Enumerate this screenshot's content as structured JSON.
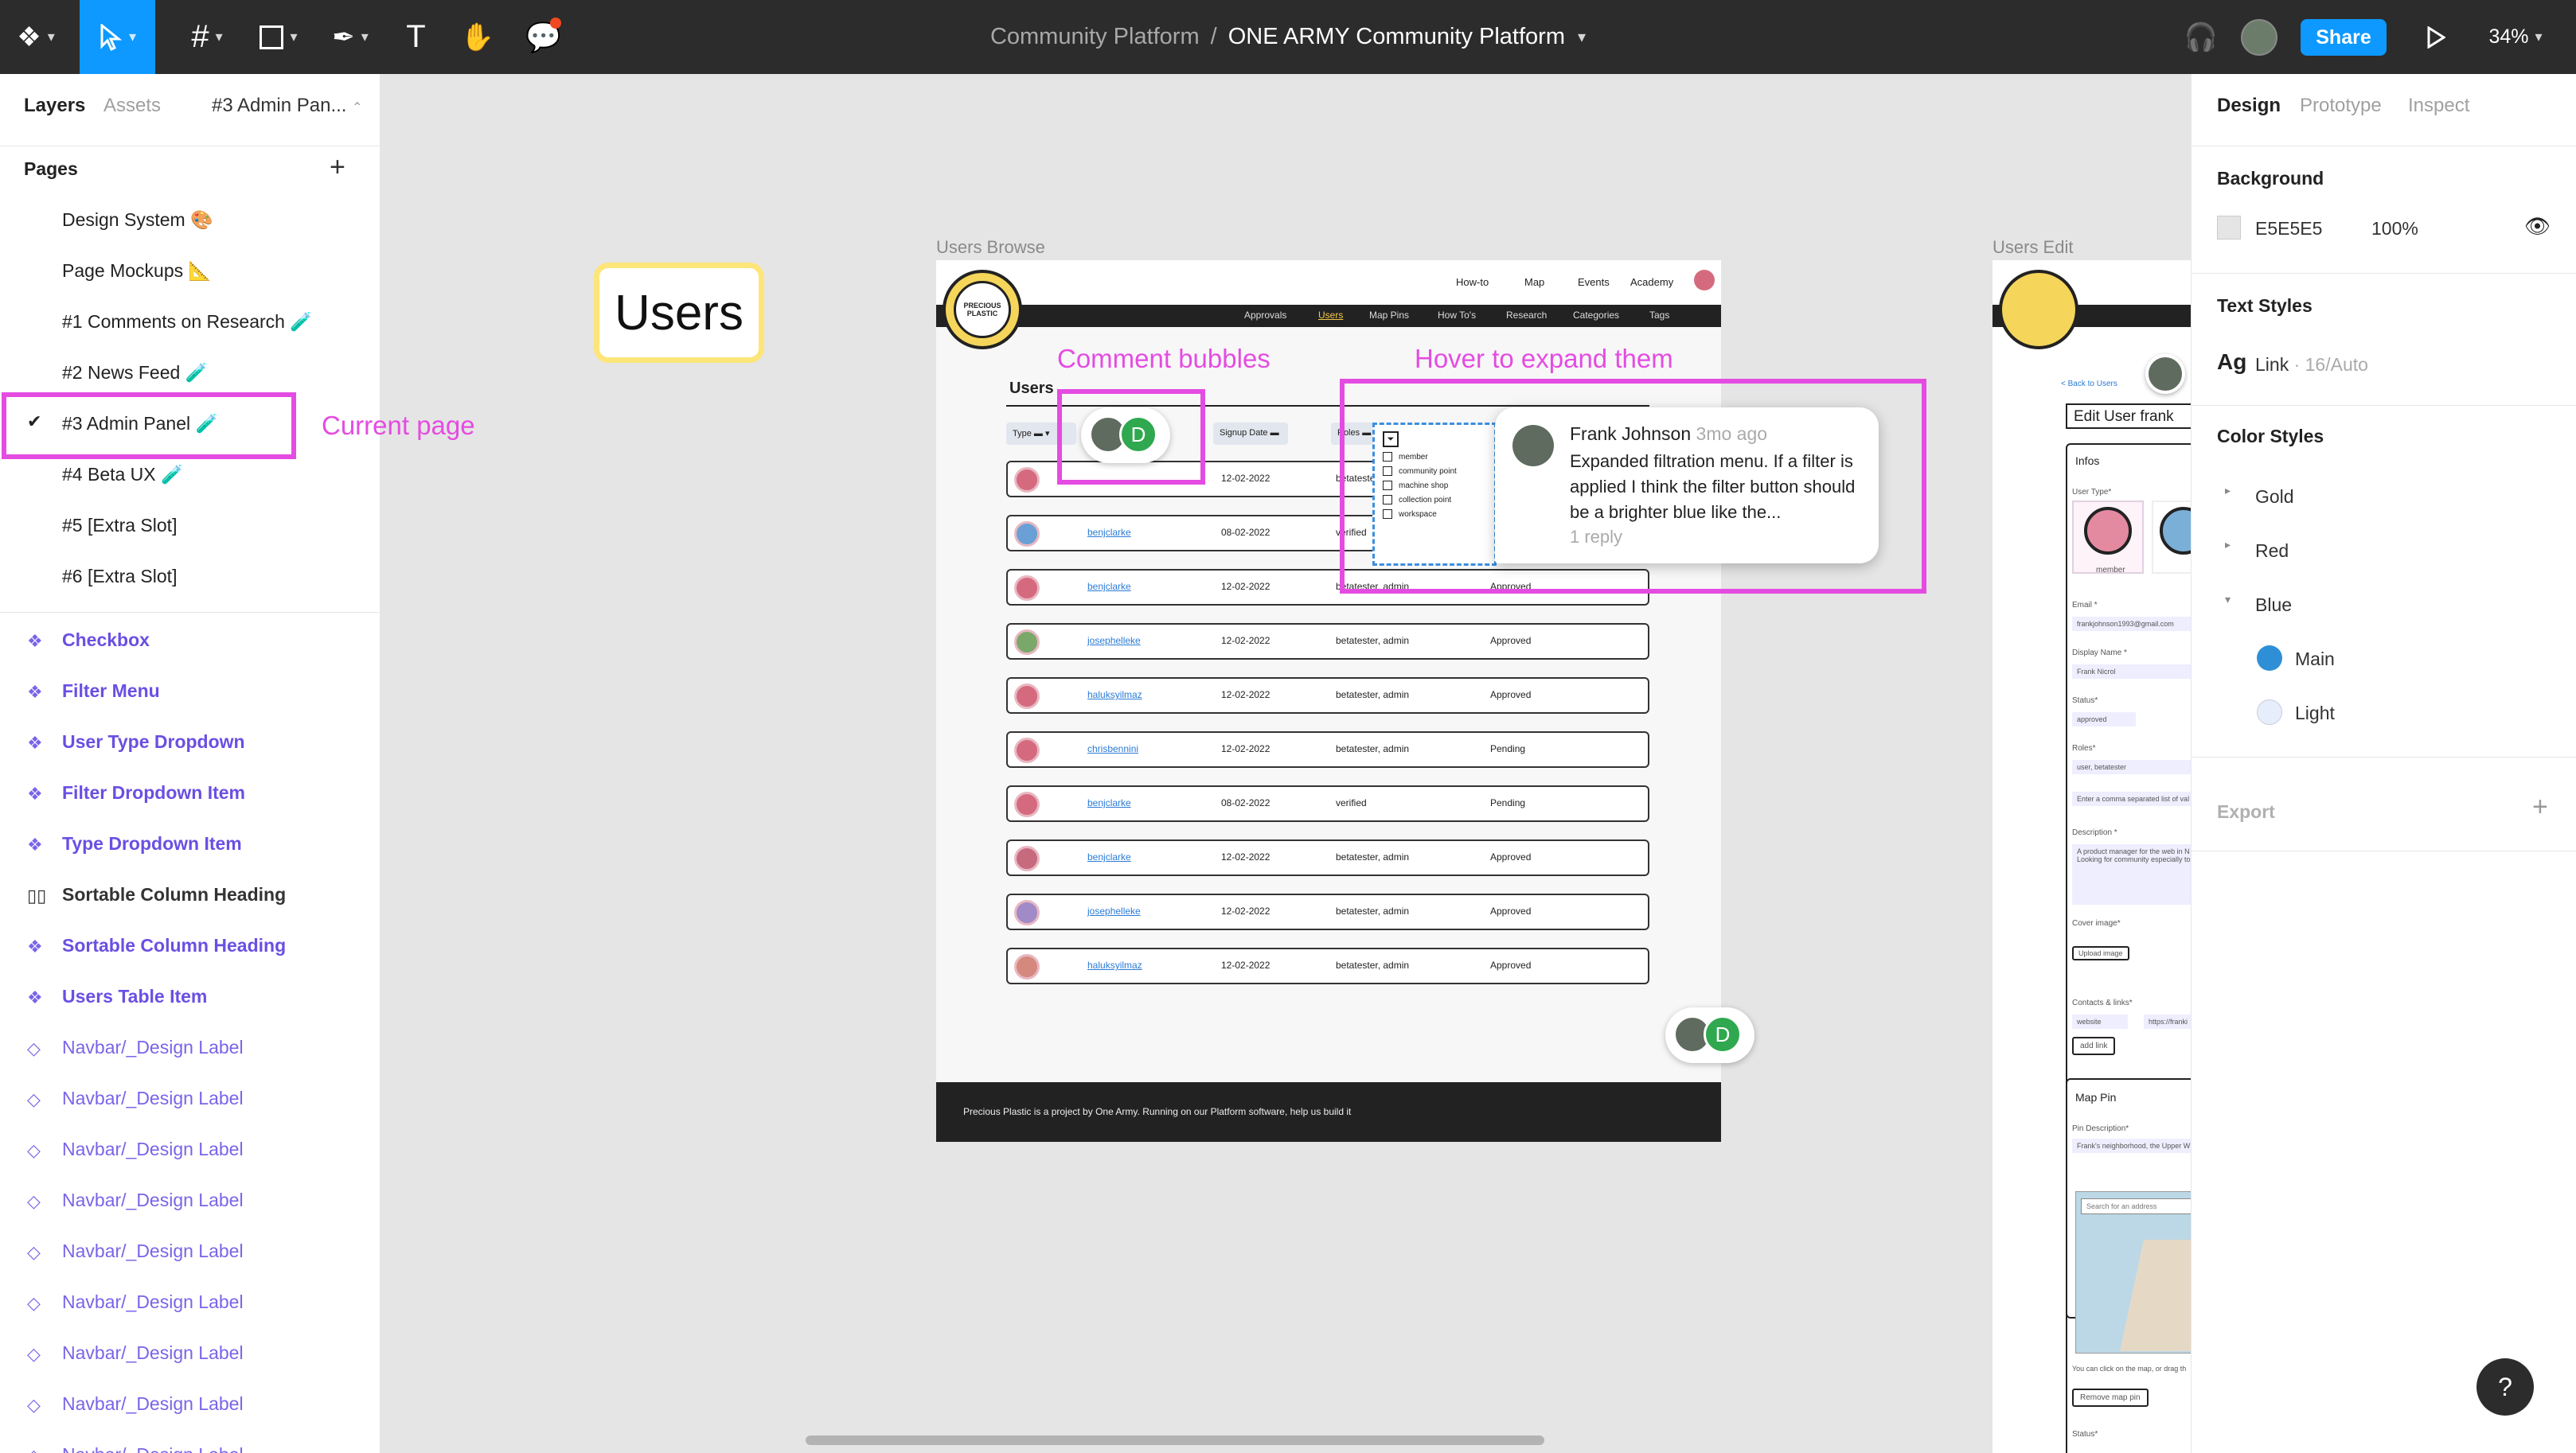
{
  "toolbar": {
    "breadcrumb_team": "Community Platform",
    "separator": "/",
    "file_name": "ONE ARMY Community Platform",
    "share_label": "Share",
    "zoom": "34%"
  },
  "left_panel": {
    "tabs": [
      "Layers",
      "Assets"
    ],
    "current_page_tab": "#3 Admin Pan...",
    "pages_title": "Pages",
    "pages": [
      "Design System 🎨",
      "Page Mockups 📐",
      "#1 Comments on Research 🧪",
      "#2 News Feed 🧪",
      "#3 Admin Panel 🧪",
      "#4 Beta UX 🧪",
      "#5 [Extra Slot]",
      "#6 [Extra Slot]"
    ],
    "layers": [
      {
        "label": "Checkbox",
        "kind": "comp"
      },
      {
        "label": "Filter Menu",
        "kind": "comp"
      },
      {
        "label": "User Type Dropdown",
        "kind": "comp"
      },
      {
        "label": "Filter Dropdown Item",
        "kind": "comp"
      },
      {
        "label": "Type Dropdown Item",
        "kind": "comp"
      },
      {
        "label": "Sortable Column Heading",
        "kind": "norm"
      },
      {
        "label": "Sortable Column Heading",
        "kind": "comp"
      },
      {
        "label": "Users Table Item",
        "kind": "comp"
      },
      {
        "label": "Navbar/_Design Label",
        "kind": "inst"
      },
      {
        "label": "Navbar/_Design Label",
        "kind": "inst"
      },
      {
        "label": "Navbar/_Design Label",
        "kind": "inst"
      },
      {
        "label": "Navbar/_Design Label",
        "kind": "inst"
      },
      {
        "label": "Navbar/_Design Label",
        "kind": "inst"
      },
      {
        "label": "Navbar/_Design Label",
        "kind": "inst"
      },
      {
        "label": "Navbar/_Design Label",
        "kind": "inst"
      },
      {
        "label": "Navbar/_Design Label",
        "kind": "inst"
      },
      {
        "label": "Navbar/_Design Label",
        "kind": "inst"
      }
    ]
  },
  "annotations": {
    "current_page": "Current page",
    "comment_bubbles": "Comment bubbles",
    "hover_expand": "Hover to expand them",
    "users_sticker": "Users"
  },
  "browse_frame": {
    "label": "Users Browse",
    "logo_text": "PRECIOUS PLASTIC",
    "top_nav": [
      "How-to",
      "Map",
      "Events",
      "Academy"
    ],
    "sub_nav": [
      "Approvals",
      "Users",
      "Map Pins",
      "How To's",
      "Research",
      "Categories",
      "Tags"
    ],
    "page_heading": "Users",
    "filter_type": "Type",
    "col_signup": "Signup Date",
    "col_roles": "Roles",
    "filter_options": [
      "member",
      "community point",
      "machine shop",
      "collection point",
      "workspace"
    ],
    "rows": [
      {
        "name": "",
        "date": "12-02-2022",
        "roles": "betatester",
        "status": ""
      },
      {
        "name": "benjclarke",
        "date": "08-02-2022",
        "roles": "verified",
        "status": ""
      },
      {
        "name": "benjclarke",
        "date": "12-02-2022",
        "roles": "betatester, admin",
        "status": "Approved"
      },
      {
        "name": "josephelleke",
        "date": "12-02-2022",
        "roles": "betatester, admin",
        "status": "Approved"
      },
      {
        "name": "haluksyilmaz",
        "date": "12-02-2022",
        "roles": "betatester, admin",
        "status": "Approved"
      },
      {
        "name": "chrisbennini",
        "date": "12-02-2022",
        "roles": "betatester, admin",
        "status": "Pending"
      },
      {
        "name": "benjclarke",
        "date": "08-02-2022",
        "roles": "verified",
        "status": "Pending"
      },
      {
        "name": "benjclarke",
        "date": "12-02-2022",
        "roles": "betatester, admin",
        "status": "Approved"
      },
      {
        "name": "josephelleke",
        "date": "12-02-2022",
        "roles": "betatester, admin",
        "status": "Approved"
      },
      {
        "name": "haluksyilmaz",
        "date": "12-02-2022",
        "roles": "betatester, admin",
        "status": "Approved"
      }
    ],
    "footer": "Precious Plastic is a project by One Army. Running on our Platform software, help us build it"
  },
  "comment": {
    "author": "Frank Johnson",
    "time": "3mo ago",
    "text": "Expanded filtration menu. If a filter is applied I think the filter button should be a brighter blue like the...",
    "replies": "1 reply",
    "avatar_initial": "D"
  },
  "edit_frame": {
    "label": "Users Edit",
    "back": "< Back to Users",
    "title": "Edit User frank",
    "infos": "Infos",
    "user_type": "User Type*",
    "member": "member",
    "email_label": "Email *",
    "email": "frankjohnson1993@gmail.com",
    "display_label": "Display Name *",
    "display": "Frank Nicrol",
    "status_label": "Status*",
    "status": "approved",
    "roles_label": "Roles*",
    "roles": "user, betatester",
    "roles_hint": "Enter a comma separated list of val",
    "desc_label": "Description *",
    "desc": "A product manager for the web in N",
    "desc2": "Looking for community especially to",
    "cover_label": "Cover image*",
    "upload": "Upload image",
    "contacts_label": "Contacts & links*",
    "website": "website",
    "website_val": "https://franki",
    "add_link": "add link",
    "map_pin": "Map Pin",
    "pin_desc_label": "Pin Description*",
    "pin_desc": "Frank's neighborhood, the Upper W",
    "search_addr": "Search for an address",
    "map_hint": "You can click on the map, or drag th",
    "remove_pin": "Remove map pin",
    "status2": "Status*"
  },
  "right_panel": {
    "tabs": [
      "Design",
      "Prototype",
      "Inspect"
    ],
    "background_title": "Background",
    "bg_hex": "E5E5E5",
    "bg_opacity": "100%",
    "text_styles_title": "Text Styles",
    "text_style_ag": "Ag",
    "text_style_name": "Link",
    "text_style_meta": " · 16/Auto",
    "color_styles_title": "Color Styles",
    "color_groups": [
      "Gold",
      "Red",
      "Blue"
    ],
    "blue_styles": [
      "Main",
      "Light"
    ],
    "export_title": "Export"
  },
  "colors": {
    "accent": "#0d99ff",
    "annotation": "#e44ce1",
    "component": "#6b4fe2",
    "blue_main": "#2f8fd6",
    "blue_light": "#e6eefb"
  },
  "help_label": "?"
}
